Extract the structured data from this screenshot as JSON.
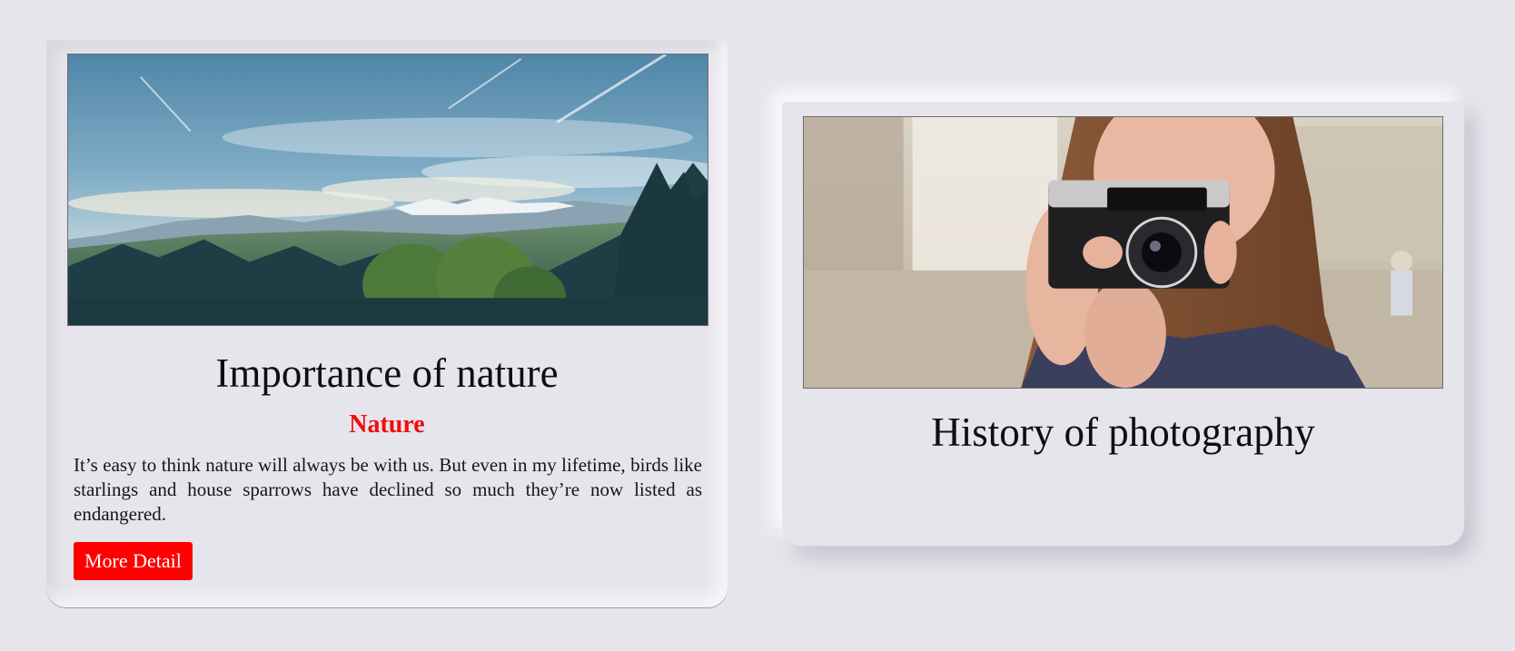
{
  "cards": [
    {
      "image_alt": "mountain landscape with forest",
      "title": "Importance of nature",
      "subtitle": "Nature",
      "text": "It’s easy to think nature will always be with us. But even in my lifetime, birds like starlings and house sparrows have declined so much they’re now listed as endangered.",
      "button_label": "More Detail",
      "button_color": "#fe0000"
    },
    {
      "image_alt": "woman holding a camera to her face",
      "title": "History of photography"
    }
  ],
  "colors": {
    "background": "#e6e5ec",
    "subtitle": "#f40b0b"
  }
}
